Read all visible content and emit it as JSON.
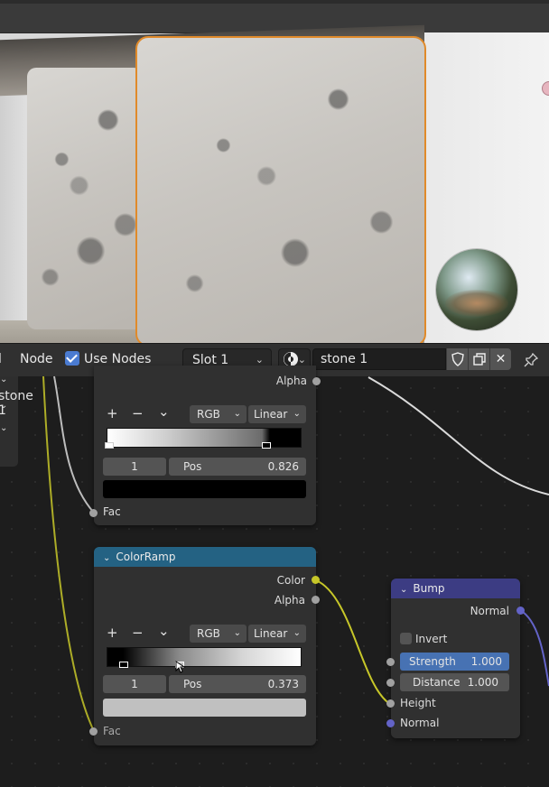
{
  "header": {
    "menu_node": "Node",
    "use_nodes_label": "Use Nodes",
    "slot": "Slot 1",
    "material_name": "stone 1",
    "left_cut_text": "l"
  },
  "left_panel": {
    "item": "stone 1"
  },
  "upper_ramp": {
    "output_alpha": "Alpha",
    "add": "+",
    "remove": "−",
    "more": "⌄",
    "color_mode": "RGB",
    "interpolation": "Linear",
    "stop_index": "1",
    "pos_label": "Pos",
    "pos_value": "0.826",
    "input_fac": "Fac",
    "stop_color": "#000000"
  },
  "lower_ramp": {
    "title": "ColorRamp",
    "output_color": "Color",
    "output_alpha": "Alpha",
    "add": "+",
    "remove": "−",
    "more": "⌄",
    "color_mode": "RGB",
    "interpolation": "Linear",
    "stop_index": "1",
    "pos_label": "Pos",
    "pos_value": "0.373",
    "input_fac": "Fac",
    "stop_color": "#c0c0c0"
  },
  "bump": {
    "title": "Bump",
    "output_normal": "Normal",
    "invert_label": "Invert",
    "strength_label": "Strength",
    "strength_value": "1.000",
    "distance_label": "Distance",
    "distance_value": "1.000",
    "input_height": "Height",
    "input_normal": "Normal"
  },
  "colors": {
    "colorramp_header": "#246283",
    "bump_header": "#3c3c83",
    "socket_float": "#a1a1a1",
    "socket_color": "#c7c729",
    "socket_vector": "#6363c7",
    "selection_outline": "#e08a2a"
  },
  "icons": [
    "shield-icon",
    "duplicate-icon",
    "close-icon",
    "pin-icon",
    "material-sphere-icon",
    "checkbox-checked-icon",
    "chevron-down-icon"
  ]
}
